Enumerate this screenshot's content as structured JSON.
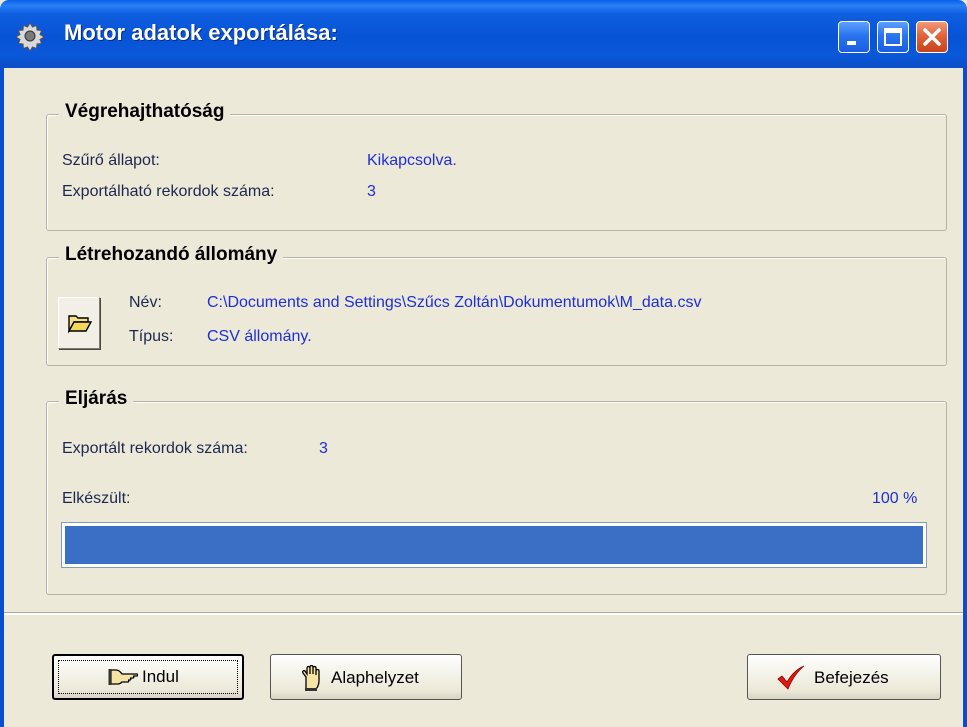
{
  "window": {
    "title": "Motor adatok exportálása:",
    "icon": "gear-icon",
    "controls": [
      "minimize-icon",
      "maximize-icon",
      "close-icon"
    ]
  },
  "feasibility": {
    "title": "Végrehajthatóság",
    "filter_label": "Szűrő állapot:",
    "filter_value": "Kikapcsolva.",
    "records_label": "Exportálható rekordok száma:",
    "records_value": "3"
  },
  "output_file": {
    "title": "Létrehozandó állomány",
    "name_label": "Név:",
    "name_value": "C:\\Documents and Settings\\Szűcs Zoltán\\Dokumentumok\\M_data.csv",
    "type_label": "Típus:",
    "type_value": "CSV állomány.",
    "browse_icon": "folder-open-icon"
  },
  "procedure": {
    "title": "Eljárás",
    "exported_label": "Exportált rekordok száma:",
    "exported_value": "3",
    "done_label": "Elkészült:",
    "percent_text": "100 %",
    "progress": 1.0
  },
  "buttons": {
    "start_label": "Indul",
    "start_icon": "pointing-hand-icon",
    "reset_label": "Alaphelyzet",
    "reset_icon": "hand-stop-icon",
    "finish_label": "Befejezés",
    "finish_icon": "checkmark-icon"
  },
  "colors": {
    "titlebar": "#0a58da",
    "value_text": "#1e2fd4",
    "progress_fill": "#3a6fc5",
    "face": "#ece9d8"
  }
}
